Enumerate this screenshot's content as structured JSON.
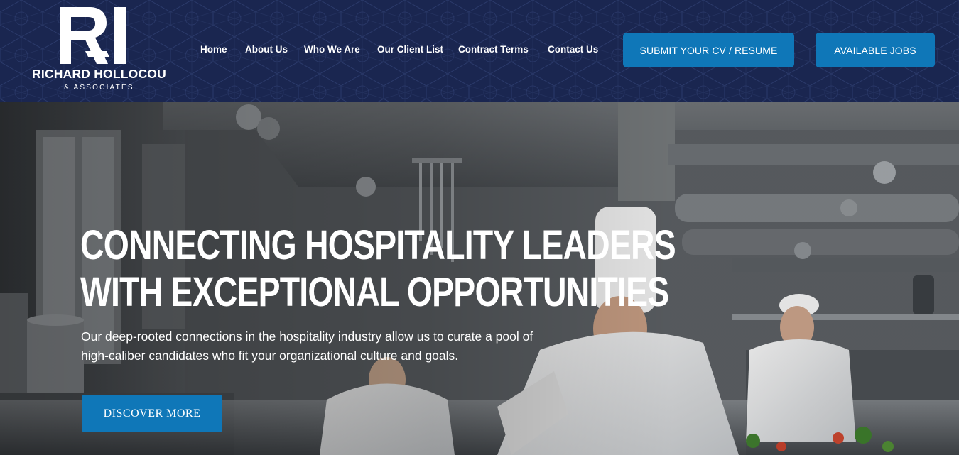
{
  "brand": {
    "name": "RICHARD HOLLOCOU",
    "subtitle": "& ASSOCIATES",
    "mark_letters": "RI"
  },
  "nav": {
    "items": [
      {
        "label": "Home"
      },
      {
        "label": "About Us"
      },
      {
        "label": "Who We Are"
      },
      {
        "label": "Our Client List"
      },
      {
        "label": "Contract Terms"
      },
      {
        "label": "Contact Us"
      }
    ]
  },
  "cta": {
    "submit_cv": "SUBMIT YOUR CV / RESUME",
    "available_jobs": "AVAILABLE JOBS"
  },
  "hero": {
    "title_line1": "CONNECTING HOSPITALITY LEADERS",
    "title_line2": "WITH EXCEPTIONAL OPPORTUNITIES",
    "description": "Our deep-rooted connections in the hospitality industry allow us to curate a pool of high-caliber candidates who fit your organizational culture and goals.",
    "button": "DISCOVER MORE",
    "background_image": "kitchen-chefs-photo"
  },
  "colors": {
    "header_bg": "#1a2650",
    "accent_blue": "#0f77b8",
    "text_white": "#ffffff"
  }
}
